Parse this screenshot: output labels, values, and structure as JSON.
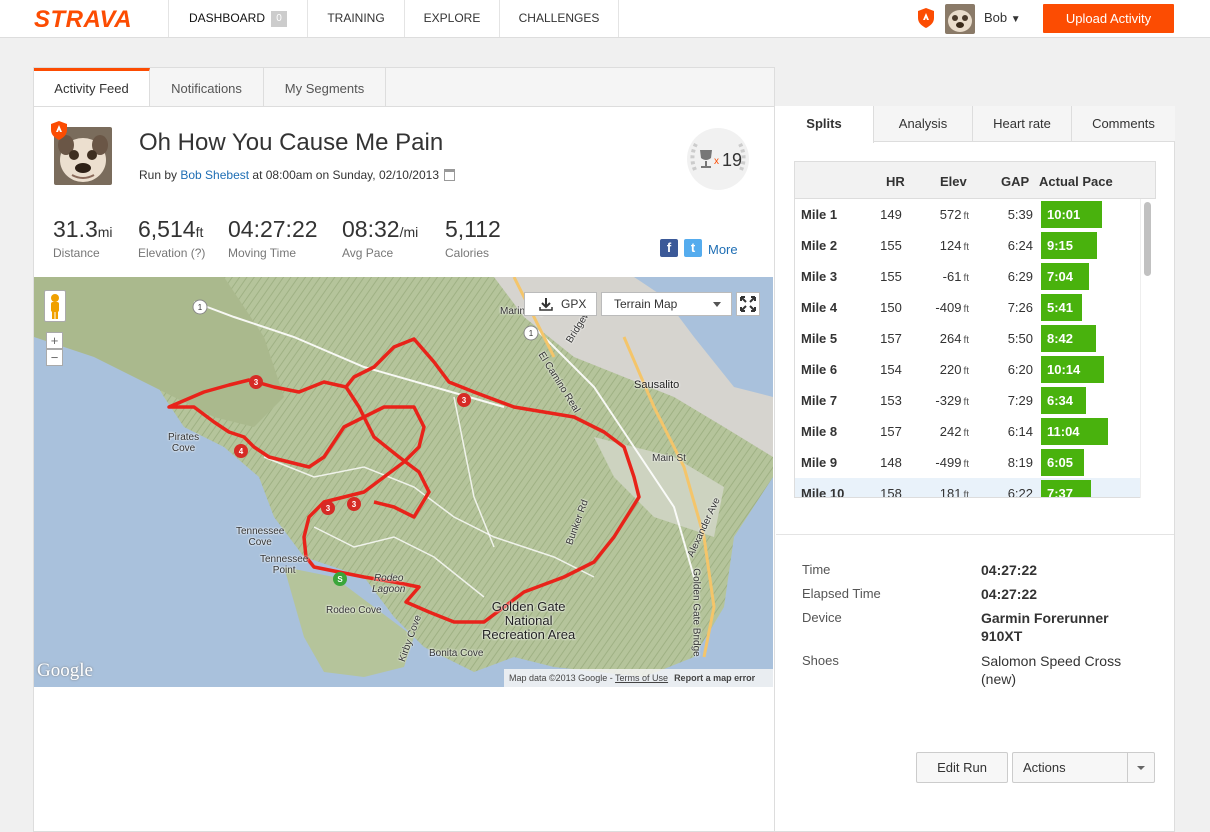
{
  "header": {
    "logo": "STRAVA",
    "nav": [
      {
        "label": "DASHBOARD",
        "badge": "0"
      },
      {
        "label": "TRAINING"
      },
      {
        "label": "EXPLORE"
      },
      {
        "label": "CHALLENGES"
      }
    ],
    "user_name": "Bob",
    "upload_label": "Upload Activity"
  },
  "feed_tabs": [
    "Activity Feed",
    "Notifications",
    "My Segments"
  ],
  "activity": {
    "title": "Oh How You Cause Me Pain",
    "sub_prefix": "Run by ",
    "athlete": "Bob Shebest",
    "sub_suffix": " at 08:00am on Sunday, 02/10/2013",
    "achievements": "19",
    "achievements_x": "x",
    "stats": [
      {
        "value": "31.3",
        "unit": "mi",
        "label": "Distance"
      },
      {
        "value": "6,514",
        "unit": "ft",
        "label": "Elevation (?)"
      },
      {
        "value": "04:27:22",
        "unit": "",
        "label": "Moving Time"
      },
      {
        "value": "08:32",
        "unit": "/mi",
        "label": "Avg Pace"
      },
      {
        "value": "5,112",
        "unit": "",
        "label": "Calories"
      }
    ],
    "more_label": "More"
  },
  "map": {
    "gpx_label": "GPX",
    "map_type": "Terrain Map",
    "google": "Google",
    "credit": "Map data ©2013 Google - ",
    "terms": "Terms of Use",
    "report": "Report a map error",
    "places": {
      "marin": "Marin City",
      "sausalito": "Sausalito",
      "pirates": "Pirates\nCove",
      "tennessee_cove": "Tennessee\nCove",
      "tennessee_point": "Tennessee\nPoint",
      "rodeo_lagoon": "Rodeo\nLagoon",
      "rodeo_cove": "Rodeo Cove",
      "ggnra": "Golden Gate\nNational\nRecreation Area",
      "bonita": "Bonita Cove",
      "main_st": "Main St",
      "el_camino": "El Camino Real",
      "bridgeway": "Bridgeway",
      "bunker": "Bunker Rd",
      "ggb": "Golden Gate Bridge",
      "alexander": "Alexander Ave",
      "kirby": "Kirby Cove"
    }
  },
  "splits": {
    "tabs": [
      "Splits",
      "Analysis",
      "Heart rate",
      "Comments"
    ],
    "headers": {
      "hr": "HR",
      "elev": "Elev",
      "gap": "GAP",
      "pace": "Actual Pace"
    },
    "elev_unit": "ft",
    "rows": [
      {
        "mile": "Mile 1",
        "hr": "149",
        "elev": "572",
        "gap": "5:39",
        "pace": "10:01",
        "pace_fraction": 0.61
      },
      {
        "mile": "Mile 2",
        "hr": "155",
        "elev": "124",
        "gap": "6:24",
        "pace": "9:15",
        "pace_fraction": 0.56
      },
      {
        "mile": "Mile 3",
        "hr": "155",
        "elev": "-61",
        "gap": "6:29",
        "pace": "7:04",
        "pace_fraction": 0.48
      },
      {
        "mile": "Mile 4",
        "hr": "150",
        "elev": "-409",
        "gap": "7:26",
        "pace": "5:41",
        "pace_fraction": 0.41
      },
      {
        "mile": "Mile 5",
        "hr": "157",
        "elev": "264",
        "gap": "5:50",
        "pace": "8:42",
        "pace_fraction": 0.55
      },
      {
        "mile": "Mile 6",
        "hr": "154",
        "elev": "220",
        "gap": "6:20",
        "pace": "10:14",
        "pace_fraction": 0.63
      },
      {
        "mile": "Mile 7",
        "hr": "153",
        "elev": "-329",
        "gap": "7:29",
        "pace": "6:34",
        "pace_fraction": 0.45
      },
      {
        "mile": "Mile 8",
        "hr": "157",
        "elev": "242",
        "gap": "6:14",
        "pace": "11:04",
        "pace_fraction": 0.67
      },
      {
        "mile": "Mile 9",
        "hr": "148",
        "elev": "-499",
        "gap": "8:19",
        "pace": "6:05",
        "pace_fraction": 0.43
      },
      {
        "mile": "Mile 10",
        "hr": "158",
        "elev": "181",
        "gap": "6:22",
        "pace": "7:37",
        "pace_fraction": 0.5
      }
    ]
  },
  "details": [
    {
      "label": "Time",
      "value": "04:27:22",
      "bold": true
    },
    {
      "label": "Elapsed Time",
      "value": "04:27:22",
      "bold": true
    },
    {
      "label": "Device",
      "value": "Garmin Forerunner 910XT",
      "bold": true
    },
    {
      "label": "Shoes",
      "value": "Salomon Speed Cross (new)",
      "bold": false
    }
  ],
  "buttons": {
    "edit": "Edit Run",
    "actions": "Actions"
  },
  "colors": {
    "brand": "#fc4c02",
    "pace_bar": "#49b20d",
    "route": "#e8231a",
    "link": "#1e6eb4"
  }
}
